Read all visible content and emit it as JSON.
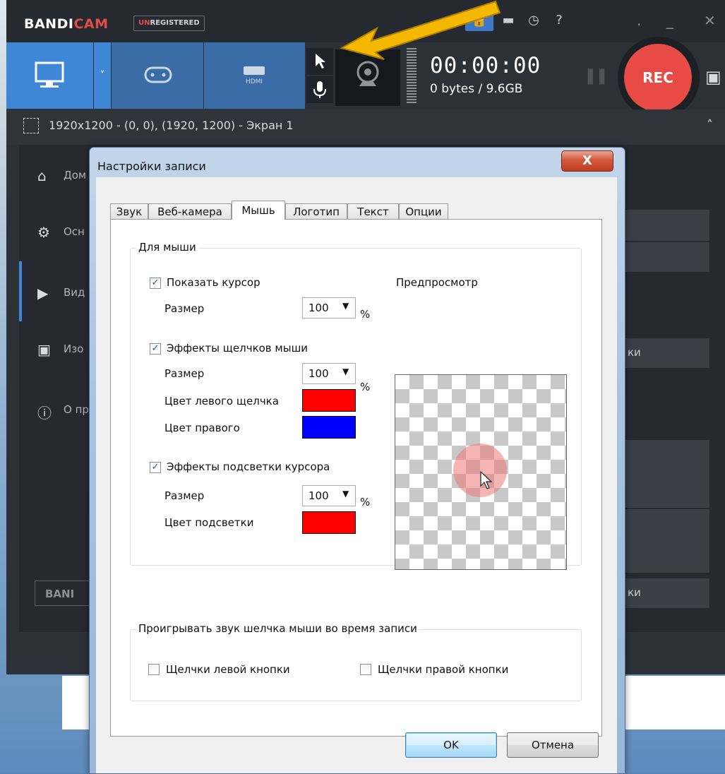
{
  "app": {
    "logo_main": "BANDI",
    "logo_accent": "CAM",
    "unreg_prefix": "UN",
    "unreg_rest": "REGISTERED",
    "timer": "00:00:00",
    "bytes": "0 bytes / 9.6GB",
    "rec_label": "REC",
    "area_text": "1920x1200 - (0, 0), (1920, 1200) - Экран 1",
    "footer_logo": "BANI"
  },
  "sidebar": {
    "items": [
      {
        "label": "Дом",
        "icon": "home-icon"
      },
      {
        "label": "Осн",
        "icon": "gear-icon"
      },
      {
        "label": "Вид",
        "icon": "video-settings-icon"
      },
      {
        "label": "Изо",
        "icon": "image-settings-icon"
      },
      {
        "label": "О пр",
        "icon": "info-icon"
      }
    ]
  },
  "background_fragments": {
    "btn_a": "ки",
    "btn_b": "ки"
  },
  "dialog": {
    "title": "Настройки записи",
    "close_label": "X",
    "tabs": [
      {
        "label": "Звук"
      },
      {
        "label": "Веб-камера"
      },
      {
        "label": "Мышь"
      },
      {
        "label": "Логотип"
      },
      {
        "label": "Текст"
      },
      {
        "label": "Опции"
      }
    ],
    "active_tab": "Мышь",
    "mouse_group": {
      "title": "Для мыши",
      "show_cursor": {
        "label": "Показать курсор",
        "checked": true
      },
      "size_label": "Размер",
      "cursor_size": "100",
      "click_effects": {
        "label": "Эффекты щелчков мыши",
        "checked": true
      },
      "click_size": "100",
      "left_click_color_label": "Цвет левого щелчка",
      "left_click_color": "#ff0000",
      "right_click_color_label": "Цвет правого",
      "right_click_color": "#0000ff",
      "highlight_effects": {
        "label": "Эффекты подсветки курсора",
        "checked": true
      },
      "highlight_size": "100",
      "highlight_color_label": "Цвет подсветки",
      "highlight_color": "#ff0000",
      "percent": "%",
      "preview_label": "Предпросмотр"
    },
    "sound_group": {
      "title": "Проигрывать звук шелчка мыши во время записи",
      "left_clicks": {
        "label": "Щелчки левой кнопки",
        "checked": false
      },
      "right_clicks": {
        "label": "Щелчки правой кнопки",
        "checked": false
      }
    },
    "ok_label": "OK",
    "cancel_label": "Отмена"
  },
  "colors": {
    "accent_blue": "#3f86d6",
    "rec_red": "#e84a45",
    "arrow_yellow": "#f5b800"
  }
}
